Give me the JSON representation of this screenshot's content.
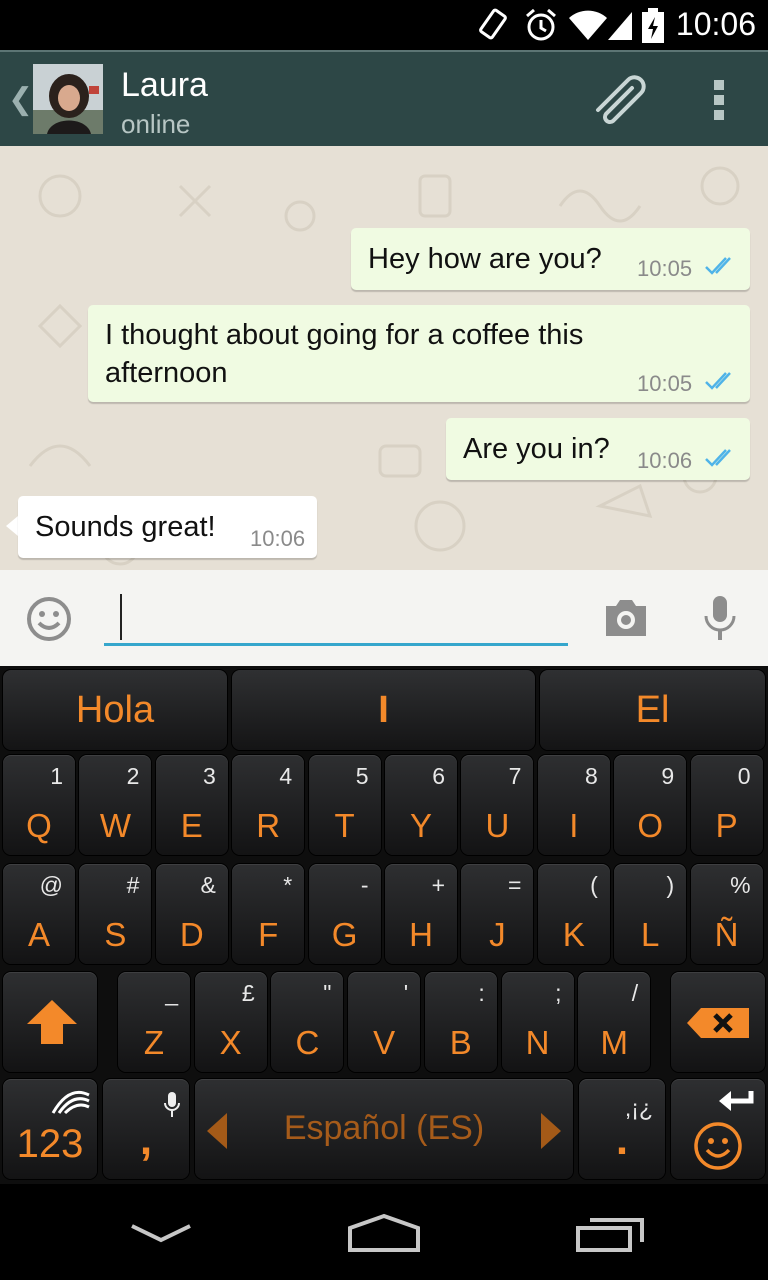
{
  "status_bar": {
    "time": "10:06",
    "icons": [
      "rotate-icon",
      "alarm-icon",
      "wifi-icon",
      "signal-icon",
      "battery-charging-icon"
    ]
  },
  "header": {
    "contact_name": "Laura",
    "contact_status": "online",
    "icons": [
      "back-chevron-icon",
      "avatar",
      "paperclip-icon",
      "overflow-menu-icon"
    ]
  },
  "messages": [
    {
      "direction": "out",
      "text": "Hey how are you?",
      "time": "10:05",
      "read": true
    },
    {
      "direction": "out",
      "text": "I thought about going for a coffee this afternoon",
      "time": "10:05",
      "read": true
    },
    {
      "direction": "out",
      "text": "Are you in?",
      "time": "10:06",
      "read": true
    },
    {
      "direction": "in",
      "text": "Sounds great!",
      "time": "10:06"
    }
  ],
  "input": {
    "value": "",
    "icons": [
      "smiley-icon",
      "camera-icon",
      "microphone-icon"
    ]
  },
  "suggestions": [
    "Hola",
    "I",
    "El"
  ],
  "keyboard": {
    "row1": [
      {
        "main": "Q",
        "alt": "1"
      },
      {
        "main": "W",
        "alt": "2"
      },
      {
        "main": "E",
        "alt": "3"
      },
      {
        "main": "R",
        "alt": "4"
      },
      {
        "main": "T",
        "alt": "5"
      },
      {
        "main": "Y",
        "alt": "6"
      },
      {
        "main": "U",
        "alt": "7"
      },
      {
        "main": "I",
        "alt": "8"
      },
      {
        "main": "O",
        "alt": "9"
      },
      {
        "main": "P",
        "alt": "0"
      }
    ],
    "row2": [
      {
        "main": "A",
        "alt": "@"
      },
      {
        "main": "S",
        "alt": "#"
      },
      {
        "main": "D",
        "alt": "&"
      },
      {
        "main": "F",
        "alt": "*"
      },
      {
        "main": "G",
        "alt": "-"
      },
      {
        "main": "H",
        "alt": "+"
      },
      {
        "main": "J",
        "alt": "="
      },
      {
        "main": "K",
        "alt": "("
      },
      {
        "main": "L",
        "alt": ")"
      },
      {
        "main": "Ñ",
        "alt": "%"
      }
    ],
    "row3": [
      {
        "main": "Z",
        "alt": "_"
      },
      {
        "main": "X",
        "alt": "£"
      },
      {
        "main": "C",
        "alt": "\""
      },
      {
        "main": "V",
        "alt": "'"
      },
      {
        "main": "B",
        "alt": ":"
      },
      {
        "main": "N",
        "alt": ";"
      },
      {
        "main": "M",
        "alt": "/"
      }
    ],
    "numbers_key": "123",
    "comma_key": ",",
    "space_label": "Español (ES)",
    "period_key": ".",
    "period_alt": ",¡¿"
  },
  "colors": {
    "accent_orange": "#f3892a",
    "header_bg": "#2d4746",
    "outgoing_bubble": "#f0fbe2",
    "tick_blue": "#4fb3e8"
  }
}
